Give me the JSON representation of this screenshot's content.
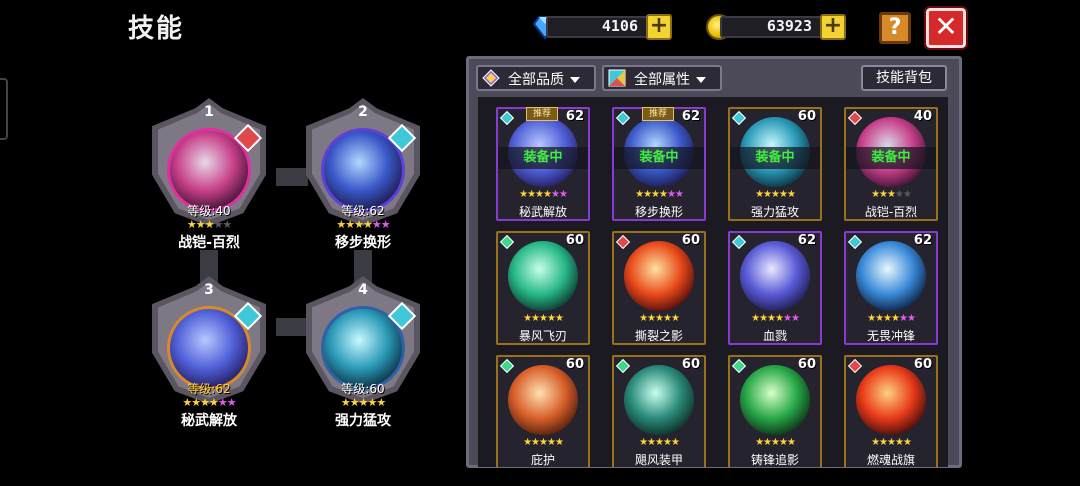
{
  "header": {
    "title": "技能",
    "gems": "4106",
    "coins": "63923",
    "plus_label": "+",
    "help_label": "?",
    "close_label": "✕"
  },
  "equipped": [
    {
      "slot": "1",
      "level": "等级:40",
      "name": "战铠-百烈",
      "stars": 3,
      "max": 5,
      "element": "fire"
    },
    {
      "slot": "2",
      "level": "等级:62",
      "name": "移步换形",
      "stars": 5,
      "max": 5,
      "element": "water",
      "purple": true
    },
    {
      "slot": "3",
      "level": "等级:62",
      "name": "秘武解放",
      "stars": 5,
      "max": 5,
      "element": "water",
      "purple": true
    },
    {
      "slot": "4",
      "level": "等级:60",
      "name": "强力猛攻",
      "stars": 5,
      "max": 5,
      "element": "water"
    }
  ],
  "filters": {
    "quality": "全部品质",
    "attribute": "全部属性",
    "bag": "技能背包"
  },
  "skills": [
    {
      "name": "秘武解放",
      "level": "62",
      "tag": "推荐",
      "equipped": "装备中",
      "stars": 5,
      "purple": true,
      "element": "water"
    },
    {
      "name": "移步换形",
      "level": "62",
      "tag": "推荐",
      "equipped": "装备中",
      "stars": 5,
      "purple": true,
      "element": "water"
    },
    {
      "name": "强力猛攻",
      "level": "60",
      "tag": "",
      "equipped": "装备中",
      "stars": 5,
      "purple": false,
      "element": "water"
    },
    {
      "name": "战铠-百烈",
      "level": "40",
      "tag": "",
      "equipped": "装备中",
      "stars": 3,
      "purple": false,
      "element": "fire"
    },
    {
      "name": "暴风飞刃",
      "level": "60",
      "tag": "",
      "equipped": "",
      "stars": 5,
      "purple": false,
      "element": "wind"
    },
    {
      "name": "撕裂之影",
      "level": "60",
      "tag": "",
      "equipped": "",
      "stars": 5,
      "purple": false,
      "element": "fire"
    },
    {
      "name": "血戮",
      "level": "62",
      "tag": "",
      "equipped": "",
      "stars": 5,
      "purple": true,
      "element": "water"
    },
    {
      "name": "无畏冲锋",
      "level": "62",
      "tag": "",
      "equipped": "",
      "stars": 5,
      "purple": true,
      "element": "water"
    },
    {
      "name": "庇护",
      "level": "60",
      "tag": "",
      "equipped": "",
      "stars": 5,
      "purple": false,
      "element": "wind"
    },
    {
      "name": "飓风装甲",
      "level": "60",
      "tag": "",
      "equipped": "",
      "stars": 5,
      "purple": false,
      "element": "wind"
    },
    {
      "name": "铸锋追影",
      "level": "60",
      "tag": "",
      "equipped": "",
      "stars": 5,
      "purple": false,
      "element": "wind"
    },
    {
      "name": "燃魂战旗",
      "level": "60",
      "tag": "",
      "equipped": "",
      "stars": 5,
      "purple": false,
      "element": "fire"
    }
  ],
  "colors": {
    "fire": "#e0484a",
    "water": "#3ec8d8",
    "wind": "#3ed88a",
    "frame_gold": "#9a7018",
    "frame_purple": "#8a3ad0"
  }
}
